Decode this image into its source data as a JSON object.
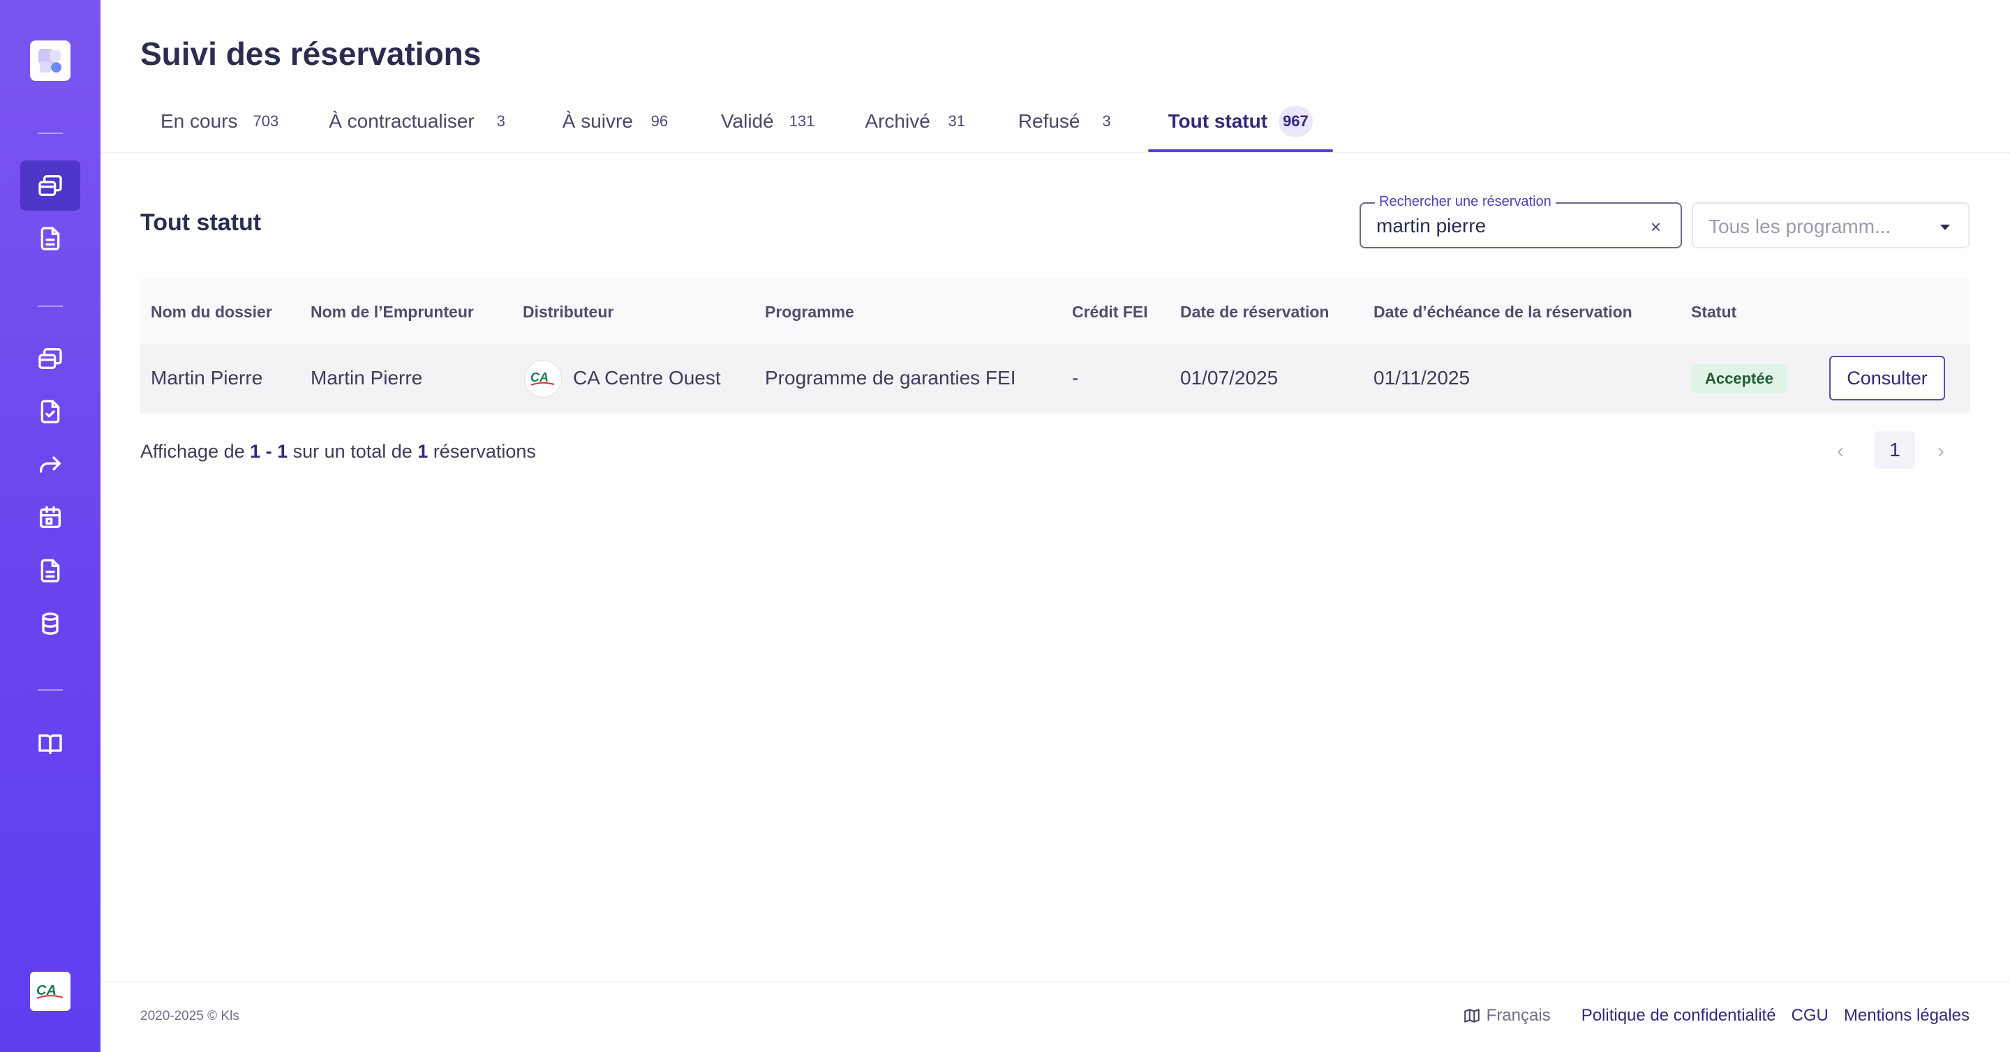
{
  "app": {
    "title": "Suivi des réservations"
  },
  "tabs": [
    {
      "label": "En cours",
      "count": "703"
    },
    {
      "label": "À contractualiser",
      "count": "3"
    },
    {
      "label": "À suivre",
      "count": "96"
    },
    {
      "label": "Validé",
      "count": "131"
    },
    {
      "label": "Archivé",
      "count": "31"
    },
    {
      "label": "Refusé",
      "count": "3"
    },
    {
      "label": "Tout statut",
      "count": "967",
      "active": true
    }
  ],
  "section": {
    "title": "Tout statut"
  },
  "search": {
    "label": "Rechercher une réservation",
    "value": "martin pierre",
    "clear": "×"
  },
  "programme_select": {
    "placeholder": "Tous les programm..."
  },
  "table": {
    "columns": [
      "Nom du dossier",
      "Nom de l’Emprunteur",
      "Distributeur",
      "Programme",
      "Crédit FEI",
      "Date de réservation",
      "Date d’échéance de la réservation",
      "Statut"
    ],
    "rows": [
      {
        "dossier": "Martin Pierre",
        "emprunteur": "Martin Pierre",
        "distributeur": "CA Centre Ouest",
        "distributeur_logo": "CA",
        "programme": "Programme de garanties FEI",
        "credit": "-",
        "date_reservation": "01/07/2025",
        "date_echeance": "01/11/2025",
        "statut": "Acceptée",
        "action": "Consulter"
      }
    ]
  },
  "pagination": {
    "prefix": "Affichage de ",
    "range": "1 - 1",
    "middle": " sur un total de ",
    "total": "1",
    "suffix": " réservations",
    "current_page": "1",
    "prev": "‹",
    "next": "›"
  },
  "footer": {
    "copyright": "2020-2025 © Kls",
    "language": "Français",
    "links": [
      "Politique de confidentialité",
      "CGU",
      "Mentions légales"
    ]
  },
  "sidebar_logo": "CA",
  "colors": {
    "accent": "#5b3fd6",
    "sidebar": "#6a45ee",
    "status_ok": "#1f5c35"
  }
}
